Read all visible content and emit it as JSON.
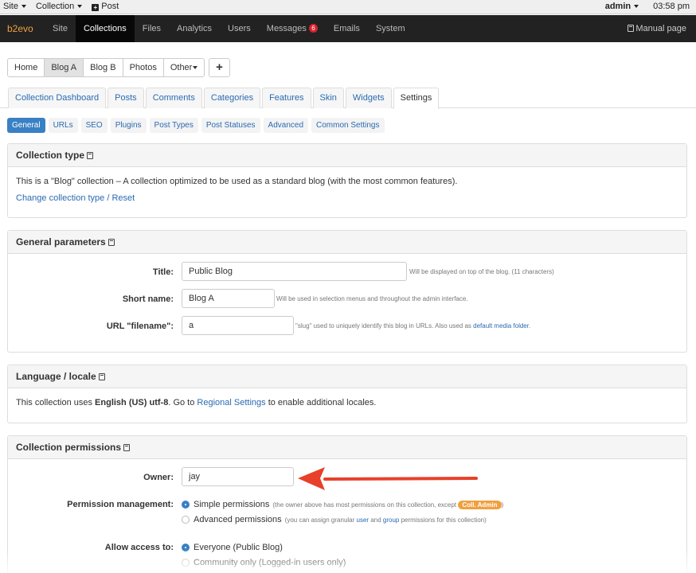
{
  "evobar": {
    "site": "Site",
    "collection": "Collection",
    "post": "Post",
    "user": "admin",
    "time": "03:58 pm"
  },
  "navbar": {
    "brand": "b2evo",
    "items": [
      "Site",
      "Collections",
      "Files",
      "Analytics",
      "Users",
      "Messages",
      "Emails",
      "System"
    ],
    "active": "Collections",
    "messages_count": "6",
    "manual": "Manual page"
  },
  "blog_tabs": {
    "items": [
      "Home",
      "Blog A",
      "Blog B",
      "Photos",
      "Other"
    ],
    "active": "Blog A",
    "add": "+"
  },
  "main_tabs": {
    "items": [
      "Collection Dashboard",
      "Posts",
      "Comments",
      "Categories",
      "Features",
      "Skin",
      "Widgets",
      "Settings"
    ],
    "active": "Settings"
  },
  "sub_tabs": {
    "items": [
      "General",
      "URLs",
      "SEO",
      "Plugins",
      "Post Types",
      "Post Statuses",
      "Advanced",
      "Common Settings"
    ],
    "active": "General"
  },
  "collection_type": {
    "title": "Collection type",
    "text": "This is a \"Blog\" collection – A collection optimized to be used as a standard blog (with the most common features).",
    "link": "Change collection type / Reset"
  },
  "general": {
    "title": "General parameters",
    "title_label": "Title:",
    "title_value": "Public Blog",
    "title_note": "Will be displayed on top of the blog. (11 characters)",
    "short_label": "Short name:",
    "short_value": "Blog A",
    "short_note": "Will be used in selection menus and throughout the admin interface.",
    "url_label": "URL \"filename\":",
    "url_value": "a",
    "url_note": "\"slug\" used to uniquely identify this blog in URLs. Also used as",
    "url_note_link": "default media folder",
    "url_note_end": "."
  },
  "language": {
    "title": "Language / locale",
    "text1": "This collection uses ",
    "locale": "English (US) utf-8",
    "text2": ". Go to ",
    "link": "Regional Settings",
    "text3": " to enable additional locales."
  },
  "permissions": {
    "title": "Collection permissions",
    "owner_label": "Owner:",
    "owner_value": "jay",
    "pm_label": "Permission management:",
    "simple": "Simple permissions",
    "simple_note": "(the owner above has most permissions on this collection, except",
    "coll_admin": "Coll. Admin",
    "simple_note_end": ")",
    "advanced": "Advanced permissions",
    "advanced_note_a": "(you can assign granular",
    "user_link": "user",
    "and": "and",
    "group_link": "group",
    "advanced_note_b": "permissions for this collection)",
    "access_label": "Allow access to:",
    "everyone": "Everyone (Public Blog)",
    "community": "Community only (Logged-in users only)"
  },
  "colors": {
    "brand": "#f0a040",
    "navbar_bg": "#222222",
    "link": "#2a6ab3",
    "active_pill": "#3a80c4",
    "arrow": "#e8402a",
    "badge": "#d9232e"
  }
}
